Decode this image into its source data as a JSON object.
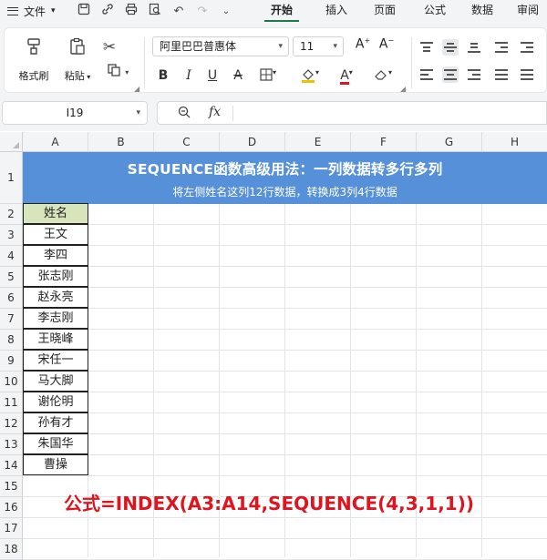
{
  "menubar": {
    "file_label": "文件",
    "tabs": [
      "开始",
      "插入",
      "页面",
      "公式",
      "数据",
      "审阅"
    ],
    "active_tab": "开始"
  },
  "ribbon": {
    "format_painter": "格式刷",
    "paste": "粘贴",
    "font_name": "阿里巴巴普惠体",
    "font_size": "11"
  },
  "formula_bar": {
    "cell_ref": "I19",
    "fx_label": "fx",
    "formula": ""
  },
  "sheet": {
    "columns": [
      "A",
      "B",
      "C",
      "D",
      "E",
      "F",
      "G",
      "H"
    ],
    "rows": [
      "1",
      "2",
      "3",
      "4",
      "5",
      "6",
      "7",
      "8",
      "9",
      "10",
      "11",
      "12",
      "13",
      "14",
      "15",
      "16",
      "17",
      "18"
    ],
    "title": "SEQUENCE函数高级用法：一列数据转多行多列",
    "subtitle": "将左侧姓名这列12行数据，转换成3列4行数据",
    "name_header": "姓名",
    "names": [
      "王文",
      "李四",
      "张志刚",
      "赵永亮",
      "李志刚",
      "王晓峰",
      "宋任一",
      "马大脚",
      "谢伦明",
      "孙有才",
      "朱国华",
      "曹操"
    ],
    "formula_note": "公式=INDEX(A3:A14,SEQUENCE(4,3,1,1))"
  },
  "colors": {
    "banner": "#5590d9",
    "header_fill": "#d7e4bc",
    "formula_note": "#e0141e",
    "active_tab_underline": "#1f7a4a"
  }
}
